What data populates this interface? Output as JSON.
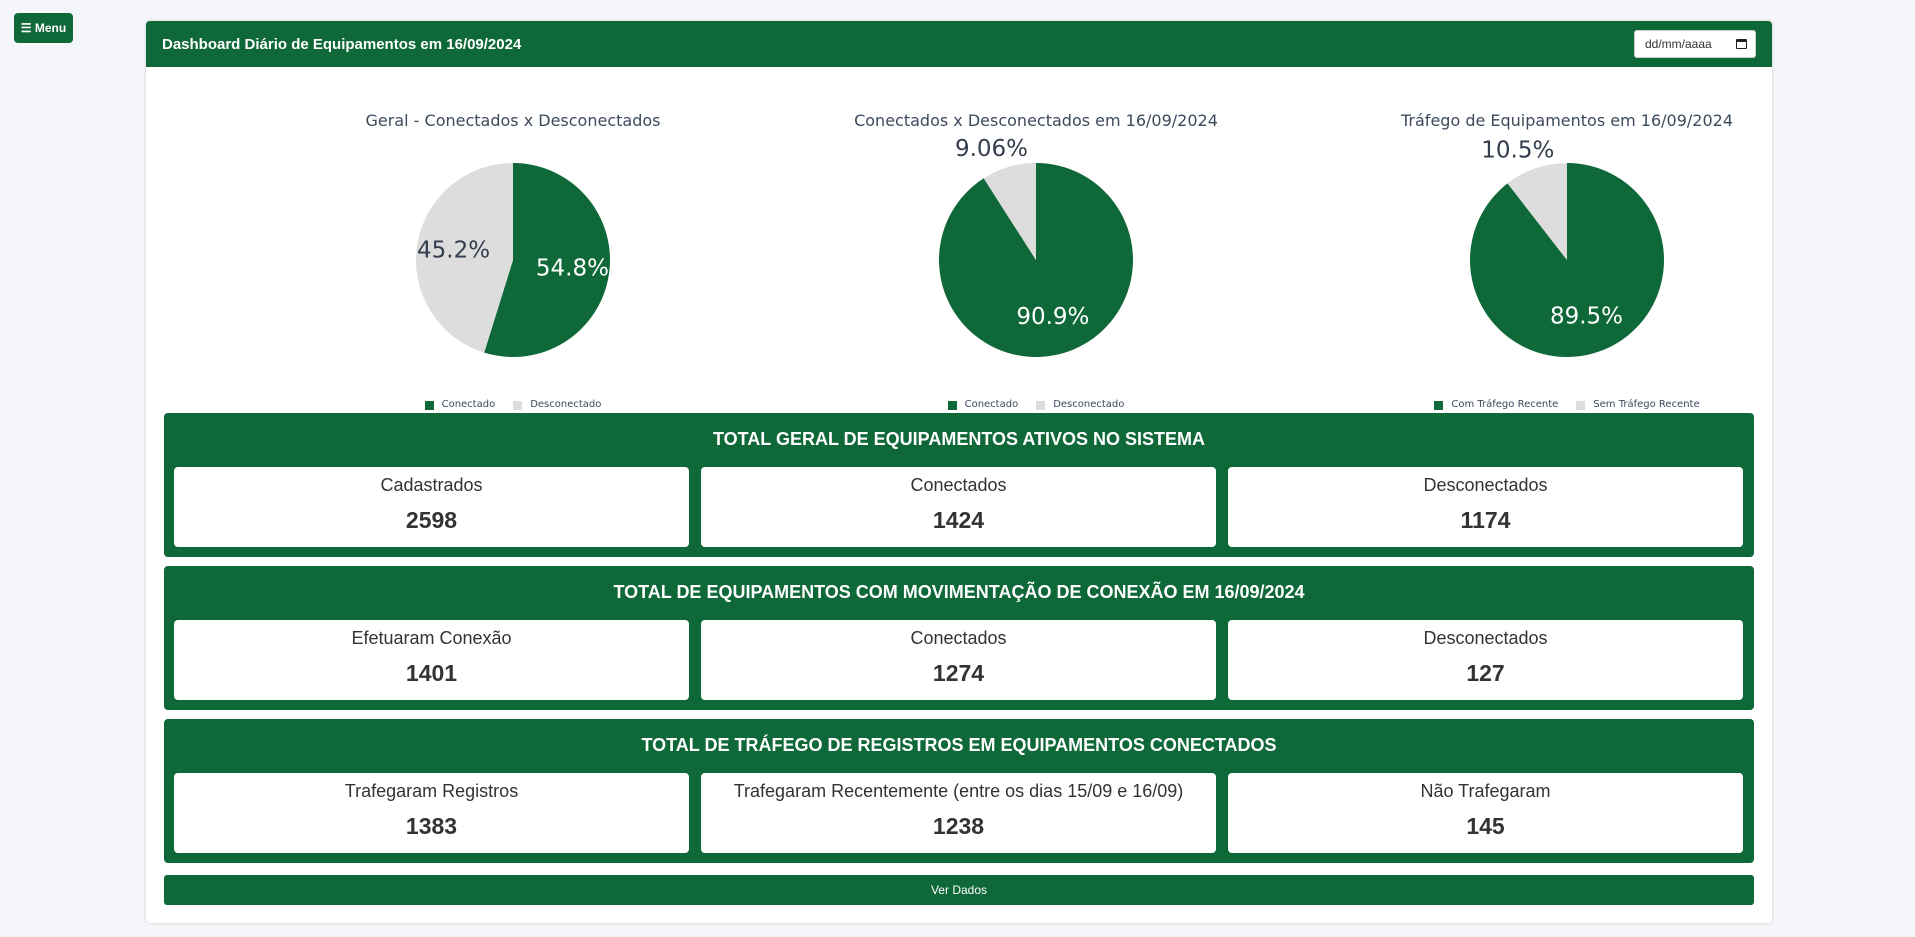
{
  "menu": {
    "label": "☰ Menu"
  },
  "header": {
    "title": "Dashboard Diário de Equipamentos em 16/09/2024",
    "date_placeholder": "dd/mm/aaaa"
  },
  "colors": {
    "primary": "#0e6838",
    "secondary": "#dddddd",
    "background": "#f4f6f9"
  },
  "chart_data": [
    {
      "type": "pie",
      "title": "Geral - Conectados x Desconectados",
      "categories": [
        "Conectado",
        "Desconectado"
      ],
      "values": [
        54.8,
        45.2
      ],
      "labels": [
        "54.8%",
        "45.2%"
      ],
      "colors": [
        "#0e6838",
        "#dddddd"
      ],
      "legend": "bottom"
    },
    {
      "type": "pie",
      "title": "Conectados x Desconectados em 16/09/2024",
      "categories": [
        "Conectado",
        "Desconectado"
      ],
      "values": [
        90.9,
        9.06
      ],
      "labels": [
        "90.9%",
        "9.06%"
      ],
      "colors": [
        "#0e6838",
        "#dddddd"
      ],
      "legend": "bottom"
    },
    {
      "type": "pie",
      "title": "Tráfego de Equipamentos em 16/09/2024",
      "categories": [
        "Com Tráfego Recente",
        "Sem Tráfego Recente"
      ],
      "values": [
        89.5,
        10.5
      ],
      "labels": [
        "89.5%",
        "10.5%"
      ],
      "colors": [
        "#0e6838",
        "#dddddd"
      ],
      "legend": "bottom"
    }
  ],
  "sections": [
    {
      "title": "TOTAL GERAL DE EQUIPAMENTOS ATIVOS NO SISTEMA",
      "stats": [
        {
          "label": "Cadastrados",
          "value": "2598"
        },
        {
          "label": "Conectados",
          "value": "1424"
        },
        {
          "label": "Desconectados",
          "value": "1174"
        }
      ]
    },
    {
      "title": "TOTAL DE EQUIPAMENTOS COM MOVIMENTAÇÃO DE CONEXÃO EM 16/09/2024",
      "stats": [
        {
          "label": "Efetuaram Conexão",
          "value": "1401"
        },
        {
          "label": "Conectados",
          "value": "1274"
        },
        {
          "label": "Desconectados",
          "value": "127"
        }
      ]
    },
    {
      "title": "TOTAL DE TRÁFEGO DE REGISTROS EM EQUIPAMENTOS CONECTADOS",
      "stats": [
        {
          "label": "Trafegaram Registros",
          "value": "1383"
        },
        {
          "label": "Trafegaram Recentemente (entre os dias 15/09 e 16/09)",
          "value": "1238"
        },
        {
          "label": "Não Trafegaram",
          "value": "145"
        }
      ]
    }
  ],
  "footer": {
    "button_label": "Ver Dados"
  }
}
